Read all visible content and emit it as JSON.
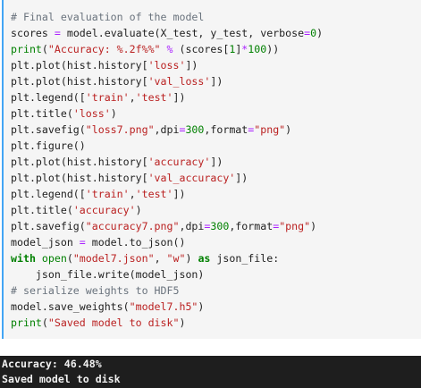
{
  "code_lines": [
    [
      {
        "t": "# Final evaluation of the model",
        "c": "cmt"
      }
    ],
    [
      {
        "t": "scores ",
        "c": "fn"
      },
      {
        "t": "=",
        "c": "op"
      },
      {
        "t": " model.evaluate(X_test, y_test, verbose",
        "c": "fn"
      },
      {
        "t": "=",
        "c": "op"
      },
      {
        "t": "0",
        "c": "num"
      },
      {
        "t": ")",
        "c": "fn"
      }
    ],
    [
      {
        "t": "print",
        "c": "bi"
      },
      {
        "t": "(",
        "c": "fn"
      },
      {
        "t": "\"Accuracy: %.2f%%\"",
        "c": "str"
      },
      {
        "t": " ",
        "c": "fn"
      },
      {
        "t": "%",
        "c": "op"
      },
      {
        "t": " (scores[",
        "c": "fn"
      },
      {
        "t": "1",
        "c": "num"
      },
      {
        "t": "]",
        "c": "fn"
      },
      {
        "t": "*",
        "c": "op"
      },
      {
        "t": "100",
        "c": "num"
      },
      {
        "t": "))",
        "c": "fn"
      }
    ],
    [
      {
        "t": "plt.plot(hist.history[",
        "c": "fn"
      },
      {
        "t": "'loss'",
        "c": "str"
      },
      {
        "t": "])",
        "c": "fn"
      }
    ],
    [
      {
        "t": "plt.plot(hist.history[",
        "c": "fn"
      },
      {
        "t": "'val_loss'",
        "c": "str"
      },
      {
        "t": "])",
        "c": "fn"
      }
    ],
    [
      {
        "t": "plt.legend([",
        "c": "fn"
      },
      {
        "t": "'train'",
        "c": "str"
      },
      {
        "t": ",",
        "c": "fn"
      },
      {
        "t": "'test'",
        "c": "str"
      },
      {
        "t": "])",
        "c": "fn"
      }
    ],
    [
      {
        "t": "plt.title(",
        "c": "fn"
      },
      {
        "t": "'loss'",
        "c": "str"
      },
      {
        "t": ")",
        "c": "fn"
      }
    ],
    [
      {
        "t": "plt.savefig(",
        "c": "fn"
      },
      {
        "t": "\"loss7.png\"",
        "c": "str"
      },
      {
        "t": ",dpi",
        "c": "fn"
      },
      {
        "t": "=",
        "c": "op"
      },
      {
        "t": "300",
        "c": "num"
      },
      {
        "t": ",format",
        "c": "fn"
      },
      {
        "t": "=",
        "c": "op"
      },
      {
        "t": "\"png\"",
        "c": "str"
      },
      {
        "t": ")",
        "c": "fn"
      }
    ],
    [
      {
        "t": "plt.figure()",
        "c": "fn"
      }
    ],
    [
      {
        "t": "plt.plot(hist.history[",
        "c": "fn"
      },
      {
        "t": "'accuracy'",
        "c": "str"
      },
      {
        "t": "])",
        "c": "fn"
      }
    ],
    [
      {
        "t": "plt.plot(hist.history[",
        "c": "fn"
      },
      {
        "t": "'val_accuracy'",
        "c": "str"
      },
      {
        "t": "])",
        "c": "fn"
      }
    ],
    [
      {
        "t": "plt.legend([",
        "c": "fn"
      },
      {
        "t": "'train'",
        "c": "str"
      },
      {
        "t": ",",
        "c": "fn"
      },
      {
        "t": "'test'",
        "c": "str"
      },
      {
        "t": "])",
        "c": "fn"
      }
    ],
    [
      {
        "t": "plt.title(",
        "c": "fn"
      },
      {
        "t": "'accuracy'",
        "c": "str"
      },
      {
        "t": ")",
        "c": "fn"
      }
    ],
    [
      {
        "t": "plt.savefig(",
        "c": "fn"
      },
      {
        "t": "\"accuracy7.png\"",
        "c": "str"
      },
      {
        "t": ",dpi",
        "c": "fn"
      },
      {
        "t": "=",
        "c": "op"
      },
      {
        "t": "300",
        "c": "num"
      },
      {
        "t": ",format",
        "c": "fn"
      },
      {
        "t": "=",
        "c": "op"
      },
      {
        "t": "\"png\"",
        "c": "str"
      },
      {
        "t": ")",
        "c": "fn"
      }
    ],
    [
      {
        "t": "model_json ",
        "c": "fn"
      },
      {
        "t": "=",
        "c": "op"
      },
      {
        "t": " model.to_json()",
        "c": "fn"
      }
    ],
    [
      {
        "t": "with",
        "c": "kw"
      },
      {
        "t": " ",
        "c": "fn"
      },
      {
        "t": "open",
        "c": "bi"
      },
      {
        "t": "(",
        "c": "fn"
      },
      {
        "t": "\"model7.json\"",
        "c": "str"
      },
      {
        "t": ", ",
        "c": "fn"
      },
      {
        "t": "\"w\"",
        "c": "str"
      },
      {
        "t": ") ",
        "c": "fn"
      },
      {
        "t": "as",
        "c": "kw"
      },
      {
        "t": " json_file:",
        "c": "fn"
      }
    ],
    [
      {
        "t": "    json_file.write(model_json)",
        "c": "fn"
      }
    ],
    [
      {
        "t": "# serialize weights to HDF5",
        "c": "cmt"
      }
    ],
    [
      {
        "t": "model.save_weights(",
        "c": "fn"
      },
      {
        "t": "\"model7.h5\"",
        "c": "str"
      },
      {
        "t": ")",
        "c": "fn"
      }
    ],
    [
      {
        "t": "print",
        "c": "bi"
      },
      {
        "t": "(",
        "c": "fn"
      },
      {
        "t": "\"Saved model to disk\"",
        "c": "str"
      },
      {
        "t": ")",
        "c": "fn"
      }
    ]
  ],
  "output": {
    "line1": "Accuracy: 46.48%",
    "line2": "Saved model to disk"
  },
  "colors": {
    "cell_background": "#f5f5f5",
    "cell_border_accent": "#42a5f5",
    "output_background": "#1e1e1e",
    "output_text": "#f0f0f0",
    "comment": "#6a737d",
    "builtin": "#008000",
    "string": "#ba2121",
    "operator": "#aa22ff"
  }
}
